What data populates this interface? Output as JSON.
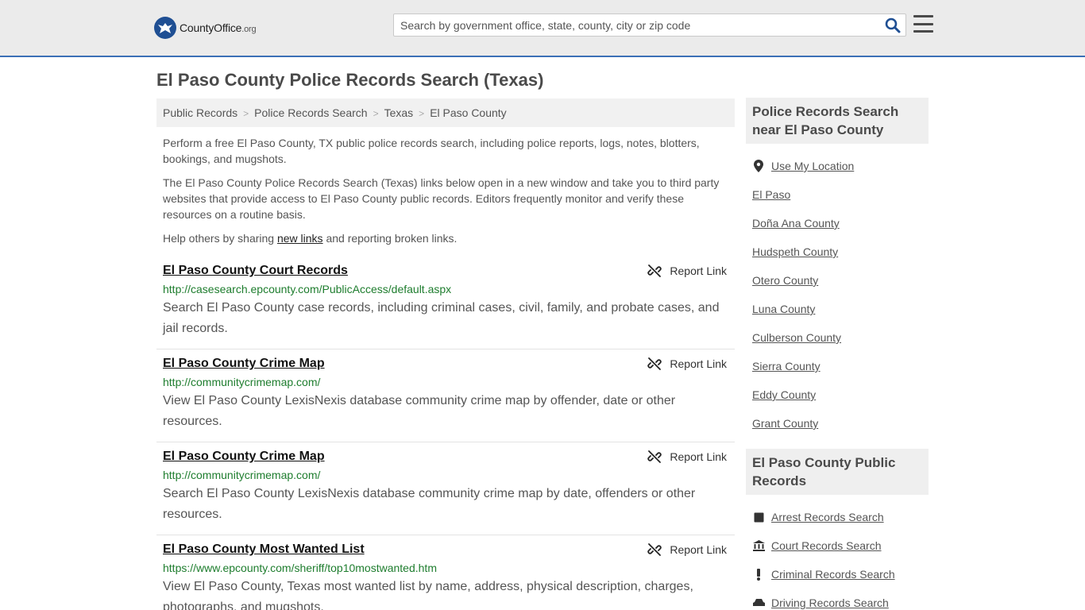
{
  "header": {
    "logo_main": "CountyOffice",
    "logo_suffix": ".org",
    "search_placeholder": "Search by government office, state, county, city or zip code"
  },
  "page_title": "El Paso County Police Records Search (Texas)",
  "breadcrumb": [
    "Public Records",
    "Police Records Search",
    "Texas",
    "El Paso County"
  ],
  "breadcrumb_sep": ">",
  "intro": {
    "p1": "Perform a free El Paso County, TX public police records search, including police reports, logs, notes, blotters, bookings, and mugshots.",
    "p2": "The El Paso County Police Records Search (Texas) links below open in a new window and take you to third party websites that provide access to El Paso County public records. Editors frequently monitor and verify these resources on a routine basis.",
    "p3_before": "Help others by sharing ",
    "p3_link": "new links",
    "p3_after": " and reporting broken links."
  },
  "report_label": "Report Link",
  "results": [
    {
      "title": "El Paso County Court Records",
      "url": "http://casesearch.epcounty.com/PublicAccess/default.aspx",
      "desc": "Search El Paso County case records, including criminal cases, civil, family, and probate cases, and jail records."
    },
    {
      "title": "El Paso County Crime Map",
      "url": "http://communitycrimemap.com/",
      "desc": "View El Paso County LexisNexis database community crime map by offender, date or other resources."
    },
    {
      "title": "El Paso County Crime Map",
      "url": "http://communitycrimemap.com/",
      "desc": "Search El Paso County LexisNexis database community crime map by date, offenders or other resources."
    },
    {
      "title": "El Paso County Most Wanted List",
      "url": "https://www.epcounty.com/sheriff/top10mostwanted.htm",
      "desc": "View El Paso County, Texas most wanted list by name, address, physical description, charges, photographs, and mugshots."
    }
  ],
  "sidebar": {
    "nearby_title": "Police Records Search near El Paso County",
    "nearby": [
      "Use My Location",
      "El Paso",
      "Doña Ana County",
      "Hudspeth County",
      "Otero County",
      "Luna County",
      "Culberson County",
      "Sierra County",
      "Eddy County",
      "Grant County"
    ],
    "public_title": "El Paso County Public Records",
    "public": [
      {
        "label": "Arrest Records Search",
        "icon": "square-icon"
      },
      {
        "label": "Court Records Search",
        "icon": "courthouse-icon"
      },
      {
        "label": "Criminal Records Search",
        "icon": "exclamation-icon"
      },
      {
        "label": "Driving Records Search",
        "icon": "car-icon"
      }
    ]
  },
  "colors": {
    "accent": "#3b6fb6",
    "link_green": "#1e7d2e",
    "header_bg": "#ebebeb"
  }
}
